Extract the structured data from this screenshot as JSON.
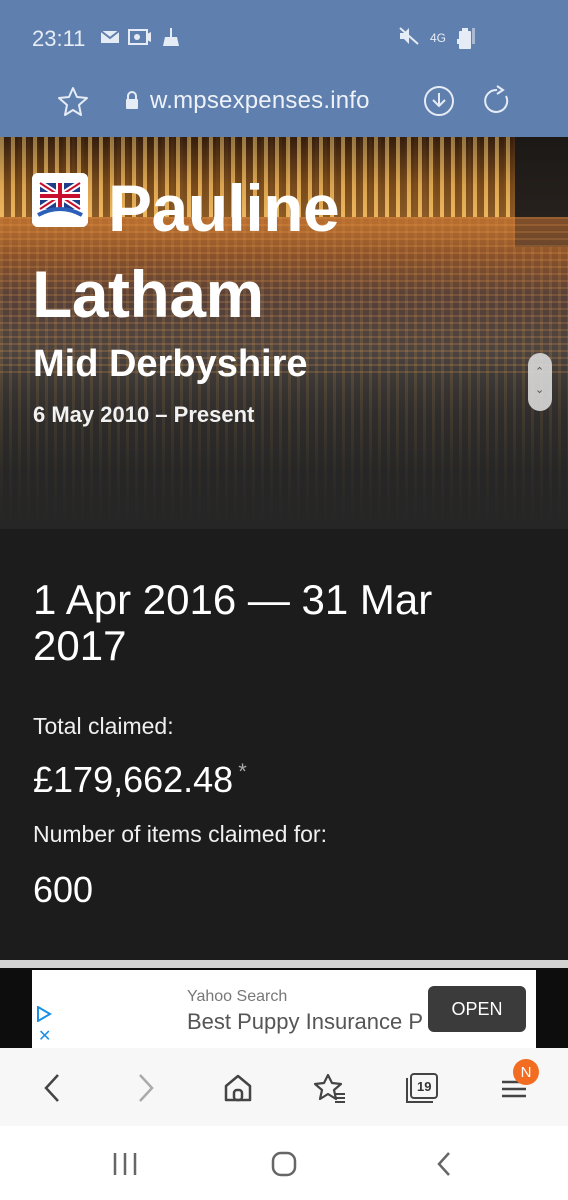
{
  "status_bar": {
    "time": "23:11",
    "network": "4G",
    "icons": [
      "mail-icon",
      "camera-icon",
      "broom-icon",
      "mute-icon",
      "signal-icon",
      "battery-icon"
    ]
  },
  "address_bar": {
    "url": "w.mpsexpenses.info"
  },
  "hero": {
    "mp_name": "Pauline Latham",
    "constituency": "Mid Derbyshire",
    "dates": "6 May 2010 – Present"
  },
  "summary": {
    "period": "1 Apr 2016 — 31 Mar 2017",
    "total_label": "Total claimed:",
    "total_value": "£179,662.48",
    "total_marker": "*",
    "items_label": "Number of items claimed for:",
    "items_value": "600"
  },
  "ad": {
    "source": "Yahoo Search",
    "title": "Best Puppy Insurance P",
    "open_label": "OPEN"
  },
  "toolbar": {
    "tabs_count": "19",
    "notification_badge": "N"
  },
  "colors": {
    "status_bar": "#5f7fae",
    "panel": "#1c1c1c",
    "notification": "#f26c22",
    "ad_button": "#3b3b3b"
  }
}
